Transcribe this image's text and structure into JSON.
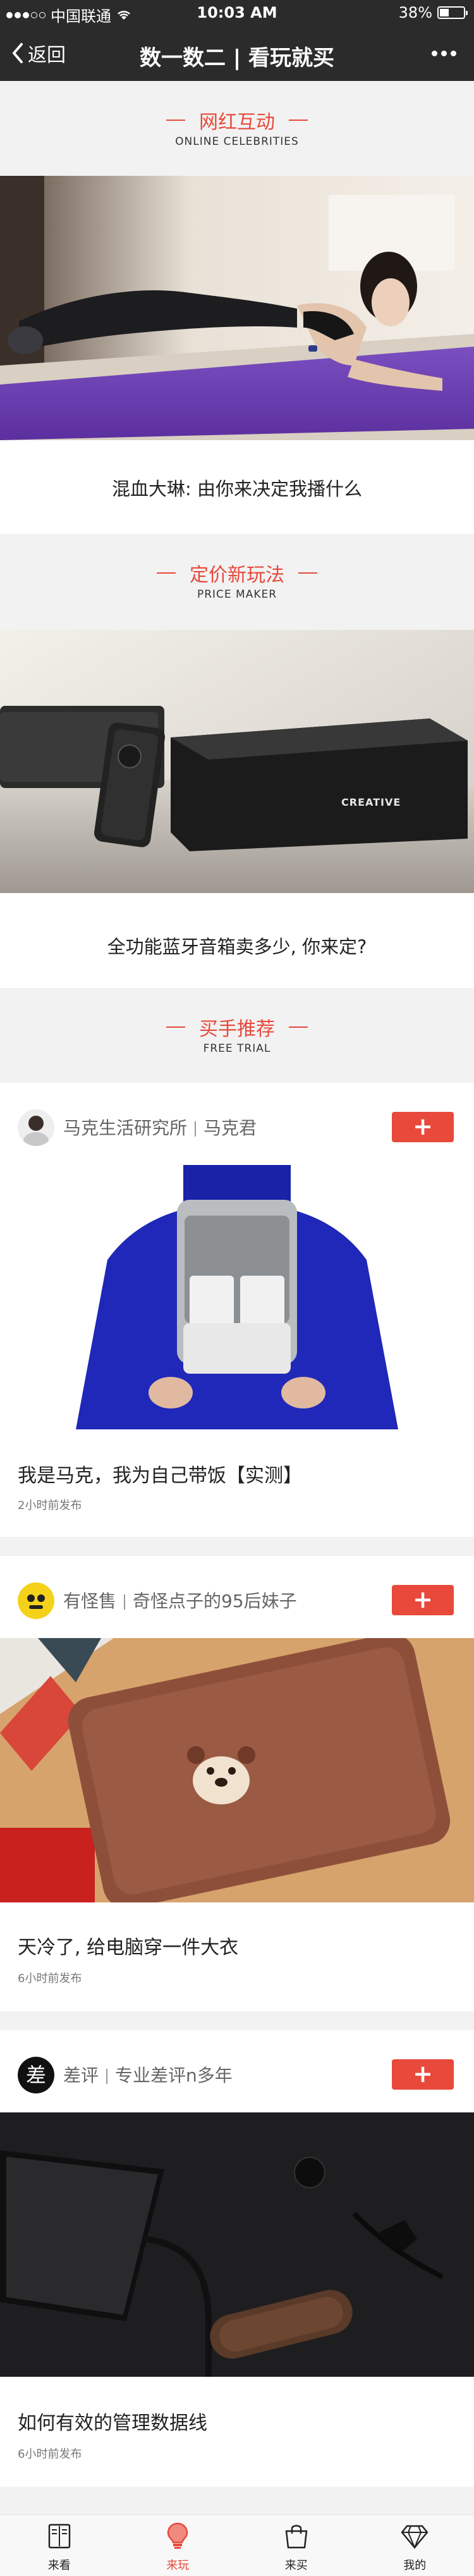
{
  "status_bar": {
    "carrier": "中国联通",
    "time": "10:03 AM",
    "battery": "38%",
    "battery_level": 0.38
  },
  "nav": {
    "back_label": "返回",
    "title": "数一数二 | 看玩就买"
  },
  "sections": [
    {
      "title_cn": "网红互动",
      "title_en": "ONLINE CELEBRITIES"
    },
    {
      "title_cn": "定价新玩法",
      "title_en": "PRICE MAKER"
    },
    {
      "title_cn": "买手推荐",
      "title_en": "FREE TRIAL"
    }
  ],
  "celebrity": {
    "caption": "混血大琳: 由你来决定我播什么"
  },
  "price_maker": {
    "caption": "全功能蓝牙音箱卖多少, 你来定?",
    "speaker_brand": "CREATIVE"
  },
  "posts": [
    {
      "author": "马克生活研究所",
      "subtitle": "马克君",
      "title": "我是马克，我为自己带饭【实测】",
      "time": "2小时前发布",
      "follow": "+"
    },
    {
      "author": "有怪售",
      "subtitle": "奇怪点子的95后妹子",
      "title": "天冷了, 给电脑穿一件大衣",
      "time": "6小时前发布",
      "follow": "+"
    },
    {
      "author": "差评",
      "subtitle": "专业差评n多年",
      "title": "如何有效的管理数据线",
      "time": "6小时前发布",
      "follow": "+",
      "avatar_char": "差"
    }
  ],
  "tabs": [
    {
      "label": "来看",
      "icon": "book-icon",
      "active": false
    },
    {
      "label": "来玩",
      "icon": "lightbulb-icon",
      "active": true
    },
    {
      "label": "来买",
      "icon": "bag-icon",
      "active": false
    },
    {
      "label": "我的",
      "icon": "diamond-icon",
      "active": false
    }
  ],
  "colors": {
    "accent": "#e8493b",
    "navbar": "#2b2b2b",
    "background": "#f2f2f2"
  }
}
